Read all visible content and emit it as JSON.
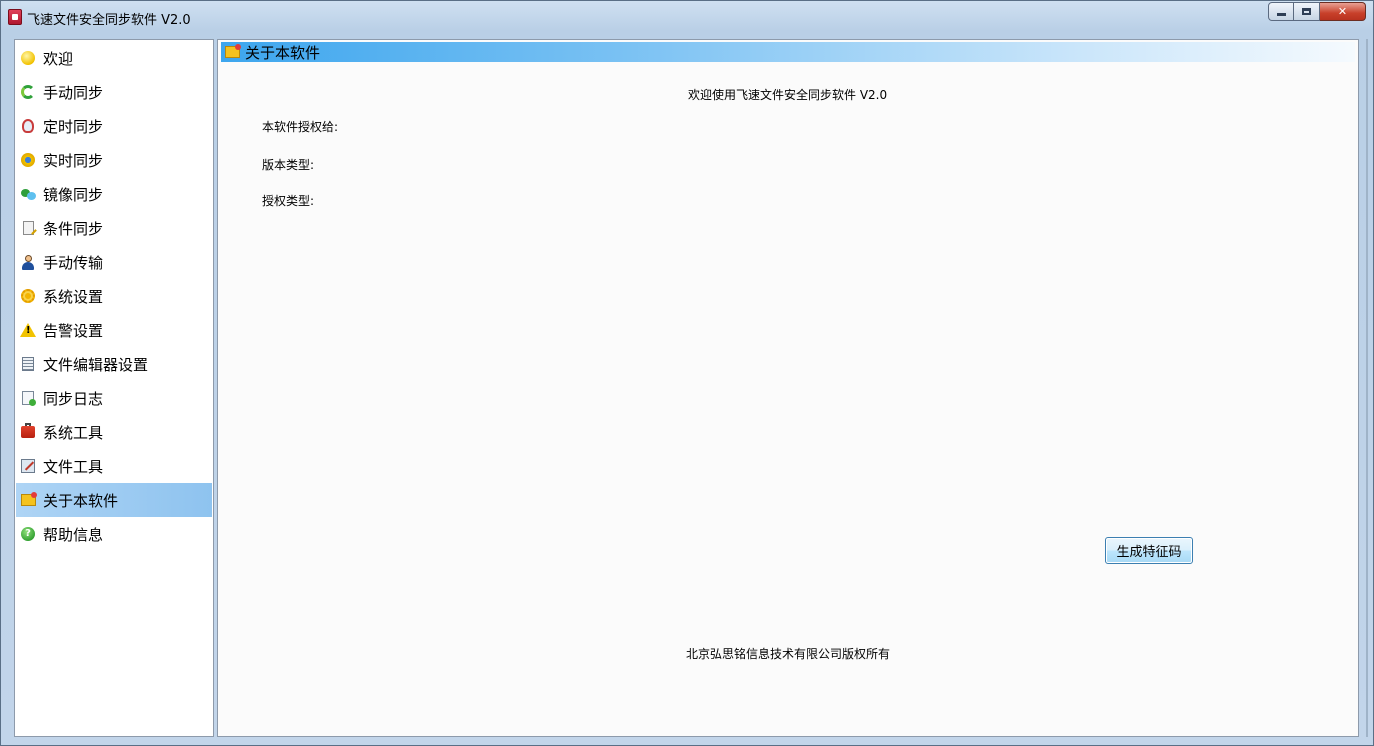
{
  "window": {
    "title": "飞速文件安全同步软件 V2.0",
    "controls": [
      "minimize",
      "maximize",
      "close"
    ]
  },
  "sidebar": {
    "selected_index": 13,
    "items": [
      {
        "label": "欢迎",
        "icon": "smiley-icon"
      },
      {
        "label": "手动同步",
        "icon": "sync-arrows-icon"
      },
      {
        "label": "定时同步",
        "icon": "alarm-clock-icon"
      },
      {
        "label": "实时同步",
        "icon": "realtime-icon"
      },
      {
        "label": "镜像同步",
        "icon": "mirror-icon"
      },
      {
        "label": "条件同步",
        "icon": "condition-doc-icon"
      },
      {
        "label": "手动传输",
        "icon": "user-icon"
      },
      {
        "label": "系统设置",
        "icon": "gear-icon"
      },
      {
        "label": "告警设置",
        "icon": "warning-icon"
      },
      {
        "label": "文件编辑器设置",
        "icon": "editor-doc-icon"
      },
      {
        "label": "同步日志",
        "icon": "log-doc-icon"
      },
      {
        "label": "系统工具",
        "icon": "toolbox-icon"
      },
      {
        "label": "文件工具",
        "icon": "file-tool-icon"
      },
      {
        "label": "关于本软件",
        "icon": "about-envelope-icon"
      },
      {
        "label": "帮助信息",
        "icon": "help-icon"
      }
    ]
  },
  "main": {
    "header_title": "关于本软件",
    "welcome_text": "欢迎使用飞速文件安全同步软件 V2.0",
    "fields": {
      "licensed_to": "本软件授权给:",
      "version_type": "版本类型:",
      "license_type": "授权类型:"
    },
    "generate_button": "生成特征码",
    "copyright": "北京弘思铭信息技术有限公司版权所有"
  },
  "colors": {
    "selected_item": "#9ccbf2",
    "header_gradient_start": "#3da6ee",
    "button_border": "#3c7fb1"
  }
}
